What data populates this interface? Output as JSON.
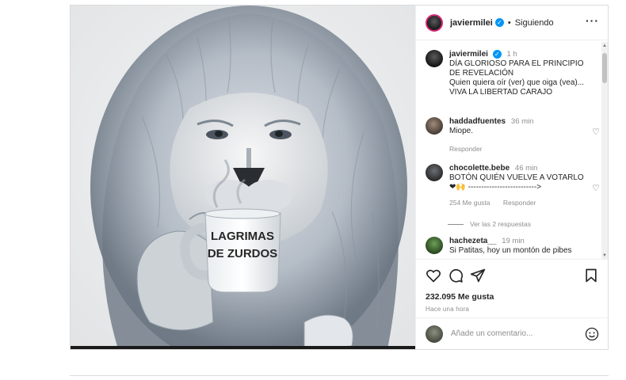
{
  "post": {
    "author": "javiermilei",
    "follow_status": "Siguiendo",
    "image_text_line1": "LAGRIMAS",
    "image_text_line2": "DE ZURDOS",
    "caption": {
      "username": "javiermilei",
      "time": "1 h",
      "line1": "DÍA GLORIOSO PARA EL PRINCIPIO DE REVELACIÓN",
      "line2": "Quien quiera oír (ver) que oiga (vea)...",
      "line3": "VIVA LA LIBERTAD CARAJO"
    }
  },
  "comments": [
    {
      "username": "haddadfuentes",
      "time": "36 min",
      "text": "Miope.",
      "reply_label": "Responder"
    },
    {
      "username": "chocolette.bebe",
      "time": "46 min",
      "text": "BOTÓN QUIÉN VUELVE A VOTARLO",
      "text2": "❤🙌 -------------------------->",
      "likes": "254 Me gusta",
      "reply_label": "Responder",
      "view_replies": "Ver las 2 respuestas"
    },
    {
      "username": "hachezeta__",
      "time": "19 min",
      "text": "Si Patitas, hoy un montón de pibes"
    }
  ],
  "actions": {
    "likes": "232.095 Me gusta",
    "posted": "Hace una hora",
    "comment_placeholder": "Añade un comentario..."
  },
  "icons": [
    "more-icon",
    "verified-icon",
    "heart-icon",
    "comment-icon",
    "share-icon",
    "bookmark-icon",
    "emoji-icon"
  ],
  "colors": {
    "verified": "#0095f6",
    "text": "#262626",
    "muted": "#8e8e8e",
    "border": "#dbdbdb"
  }
}
